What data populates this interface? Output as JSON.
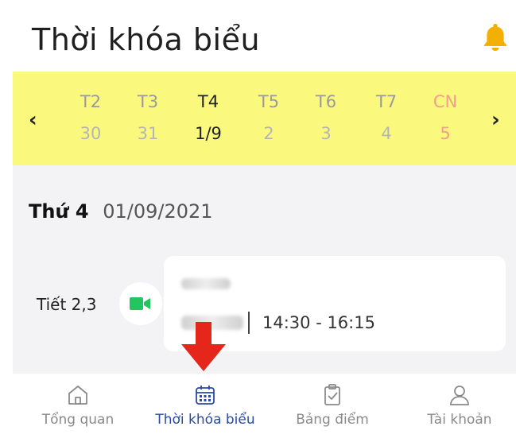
{
  "header": {
    "title": "Thời khóa biểu",
    "notification_icon": "bell-icon",
    "icon_color": "#f4b000"
  },
  "week": {
    "background": "#fbf97d",
    "prev_label": "‹",
    "next_label": "›",
    "days": [
      {
        "name": "T2",
        "date": "30"
      },
      {
        "name": "T3",
        "date": "31"
      },
      {
        "name": "T4",
        "date": "1/9",
        "active": true
      },
      {
        "name": "T5",
        "date": "2"
      },
      {
        "name": "T6",
        "date": "3"
      },
      {
        "name": "T7",
        "date": "4"
      },
      {
        "name": "CN",
        "date": "5",
        "sunday": true
      }
    ]
  },
  "schedule": {
    "day_label": "Thứ 4",
    "date": "01/09/2021",
    "lessons": [
      {
        "period": "Tiết 2,3",
        "icon": "video-camera-icon",
        "time": "14:30 - 16:15"
      }
    ]
  },
  "annotation": {
    "arrow_color": "#e5261a"
  },
  "nav": {
    "items": [
      {
        "label": "Tổng quan",
        "icon": "home-icon"
      },
      {
        "label": "Thời khóa biểu",
        "icon": "calendar-icon",
        "active": true
      },
      {
        "label": "Bảng điểm",
        "icon": "clipboard-check-icon"
      },
      {
        "label": "Tài khoản",
        "icon": "user-icon"
      }
    ],
    "active_color": "#2a4aa5"
  }
}
